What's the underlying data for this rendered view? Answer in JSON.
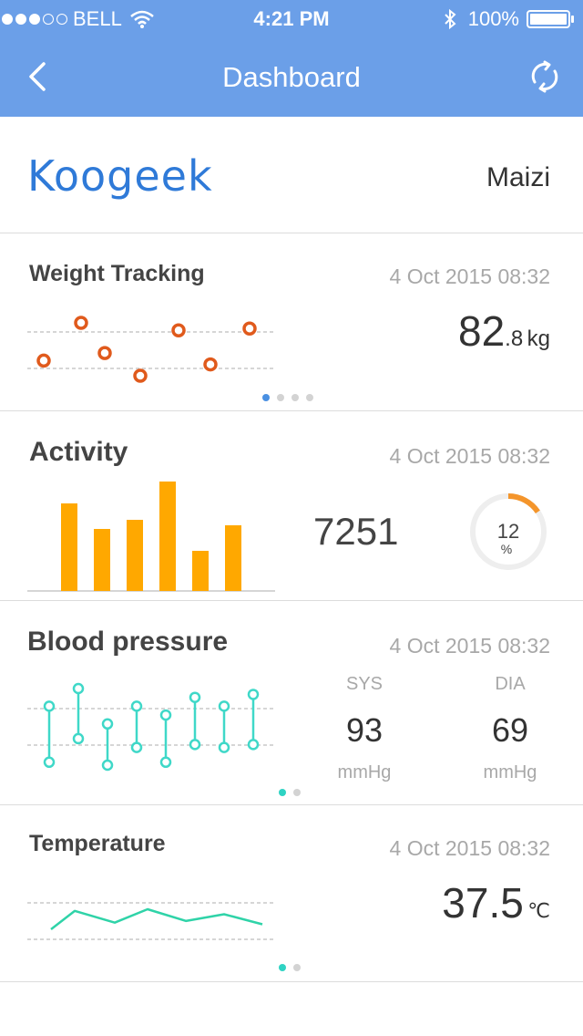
{
  "status_bar": {
    "carrier": "BELL",
    "time": "4:21 PM",
    "battery": "100%"
  },
  "nav": {
    "title": "Dashboard"
  },
  "brand": {
    "logo": "Koogeek",
    "user": "Maizi"
  },
  "weight": {
    "title": "Weight Tracking",
    "date": "4 Oct 2015 08:32",
    "value_int": "82",
    "value_dec": ".8",
    "unit": "kg",
    "colors": {
      "point": "#e05a1c",
      "gridline": "#c8c8c8"
    }
  },
  "activity": {
    "title": "Activity",
    "date": "4 Oct 2015 08:32",
    "steps": "7251",
    "percent": "12",
    "percent_unit": "%",
    "percent_value": 12,
    "colors": {
      "bar": "#ffa800",
      "ring_track": "#eeeeee",
      "ring_fill": "#f4952b"
    }
  },
  "blood_pressure": {
    "title": "Blood pressure",
    "date": "4 Oct 2015 08:32",
    "sys_label": "SYS",
    "sys_value": "93",
    "sys_unit": "mmHg",
    "dia_label": "DIA",
    "dia_value": "69",
    "dia_unit": "mmHg",
    "colors": {
      "line": "#3fd8c8"
    }
  },
  "temperature": {
    "title": "Temperature",
    "date": "4 Oct 2015 08:32",
    "value": "37.5",
    "unit": "℃",
    "colors": {
      "line": "#2fd3a8"
    }
  },
  "chart_data": [
    {
      "type": "scatter",
      "x": [
        1,
        2,
        3,
        4,
        5,
        6,
        7
      ],
      "y": [
        1.6,
        2.6,
        1.8,
        1.2,
        2.4,
        1.5,
        2.45
      ]
    },
    {
      "type": "bar",
      "values": [
        100,
        58,
        68,
        100,
        38,
        60
      ]
    },
    {
      "type": "line",
      "series": [
        {
          "name": "high",
          "values": [
            2.9,
            3.5,
            2.3,
            2.9,
            2.6,
            3.2,
            2.9,
            3.3
          ]
        },
        {
          "name": "low",
          "values": [
            1.0,
            1.8,
            0.9,
            1.5,
            1.0,
            1.6,
            1.5,
            1.6
          ]
        }
      ]
    },
    {
      "type": "line",
      "values": [
        1.0,
        2.1,
        1.4,
        2.2,
        1.5,
        1.9,
        1.3
      ]
    }
  ]
}
